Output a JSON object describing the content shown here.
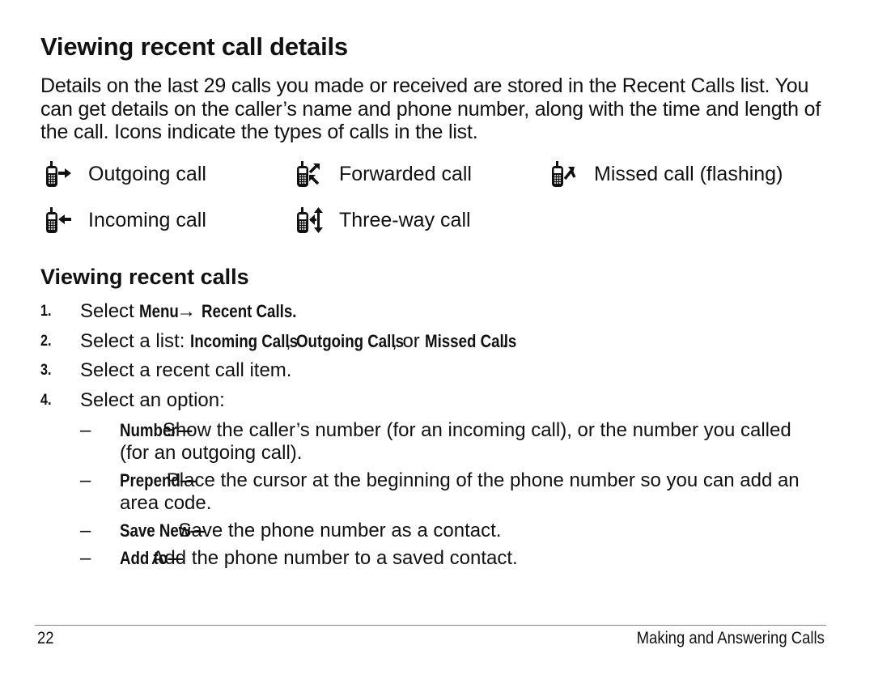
{
  "heading": "Viewing recent call details",
  "intro": "Details on the last 29 calls you made or received are stored in the Recent Calls list. You can get details on the caller’s name and phone number, along with the time and length of the call. Icons indicate the types of calls in the list.",
  "legend": [
    {
      "icon": "outgoing-call-icon",
      "label": "Outgoing call"
    },
    {
      "icon": "forwarded-call-icon",
      "label": "Forwarded call"
    },
    {
      "icon": "missed-call-icon",
      "label": "Missed call (flashing)"
    },
    {
      "icon": "incoming-call-icon",
      "label": "Incoming call"
    },
    {
      "icon": "three-way-call-icon",
      "label": "Three-way call"
    }
  ],
  "subheading": "Viewing recent calls",
  "steps": [
    {
      "num": "1.",
      "pre": "Select ",
      "b1": "Menu",
      "mid": " → ",
      "b2": "Recent Calls.",
      "post": ""
    },
    {
      "num": "2.",
      "pre": "Select a list: ",
      "b1": "Incoming Calls",
      "mid": ", ",
      "b2": "Outgoing Calls",
      "mid2": ", or ",
      "b3": "Missed Calls",
      "post": "."
    },
    {
      "num": "3.",
      "text": "Select a recent call item."
    },
    {
      "num": "4.",
      "text": "Select an option:"
    }
  ],
  "options": [
    {
      "dash": "–",
      "term": "Number—",
      "desc": "Show the caller’s number (for an incoming call), or the number you called (for an outgoing call)."
    },
    {
      "dash": "–",
      "term": "Prepend—",
      "desc": "Place the cursor at the beginning of the phone number so you can add an area code."
    },
    {
      "dash": "–",
      "term": "Save New—",
      "desc": "Save the phone number as a contact."
    },
    {
      "dash": "–",
      "term": "Add to—",
      "desc": "Add the phone number to a saved contact."
    }
  ],
  "footer": {
    "page": "22",
    "section": "Making and Answering Calls"
  }
}
